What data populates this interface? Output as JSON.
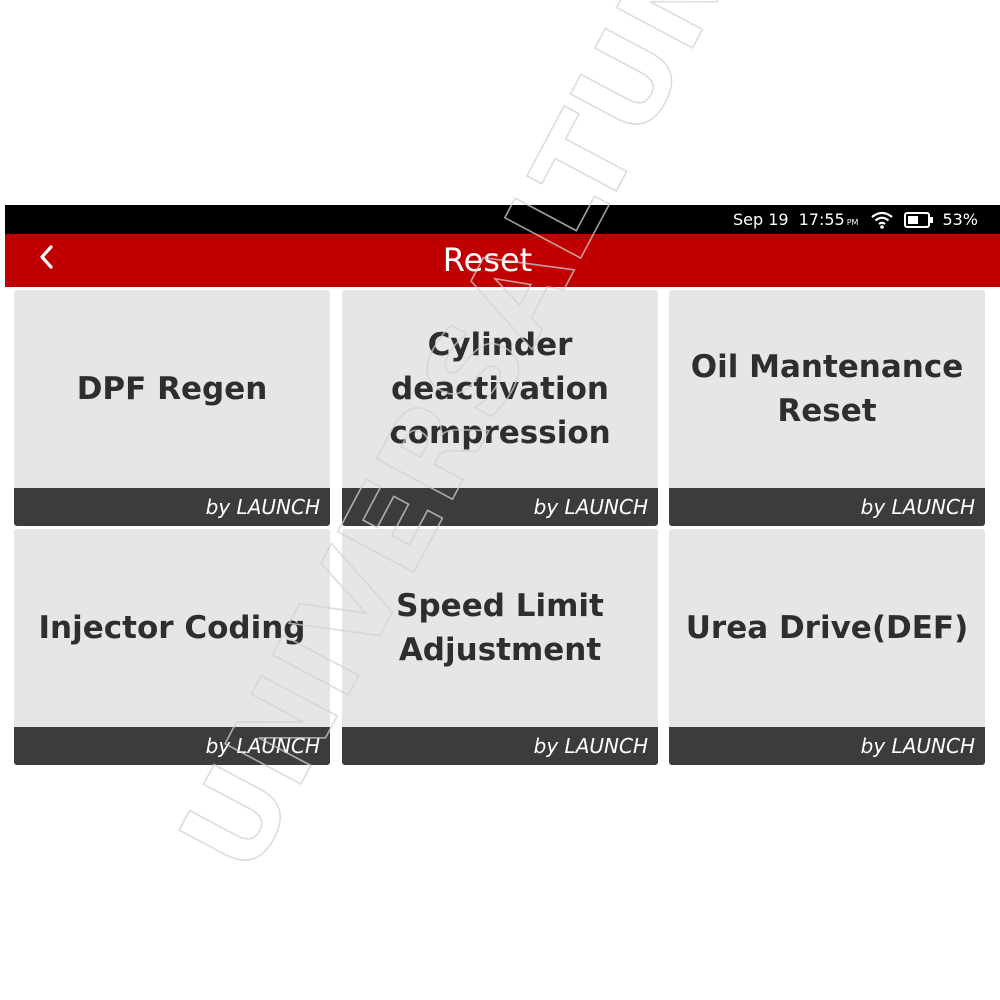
{
  "status_bar": {
    "date": "Sep 19",
    "time": "17:55",
    "ampm": "PM",
    "battery": "53%",
    "wifi_icon": "wifi-icon",
    "battery_icon": "battery-icon"
  },
  "header": {
    "title": "Reset",
    "back_icon": "chevron-left-icon",
    "color": "#c00000"
  },
  "tiles": [
    {
      "label": "DPF Regen",
      "footer": "by LAUNCH"
    },
    {
      "label": "Cylinder\ndeactivation\ncompression",
      "footer": "by LAUNCH"
    },
    {
      "label": "Oil Mantenance\nReset",
      "footer": "by LAUNCH"
    },
    {
      "label": "Injector Coding",
      "footer": "by LAUNCH"
    },
    {
      "label": "Speed Limit\nAdjustment",
      "footer": "by LAUNCH"
    },
    {
      "label": "Urea Drive(DEF)",
      "footer": "by LAUNCH"
    }
  ],
  "watermark": {
    "text": "UNIVERSALTUNING"
  }
}
